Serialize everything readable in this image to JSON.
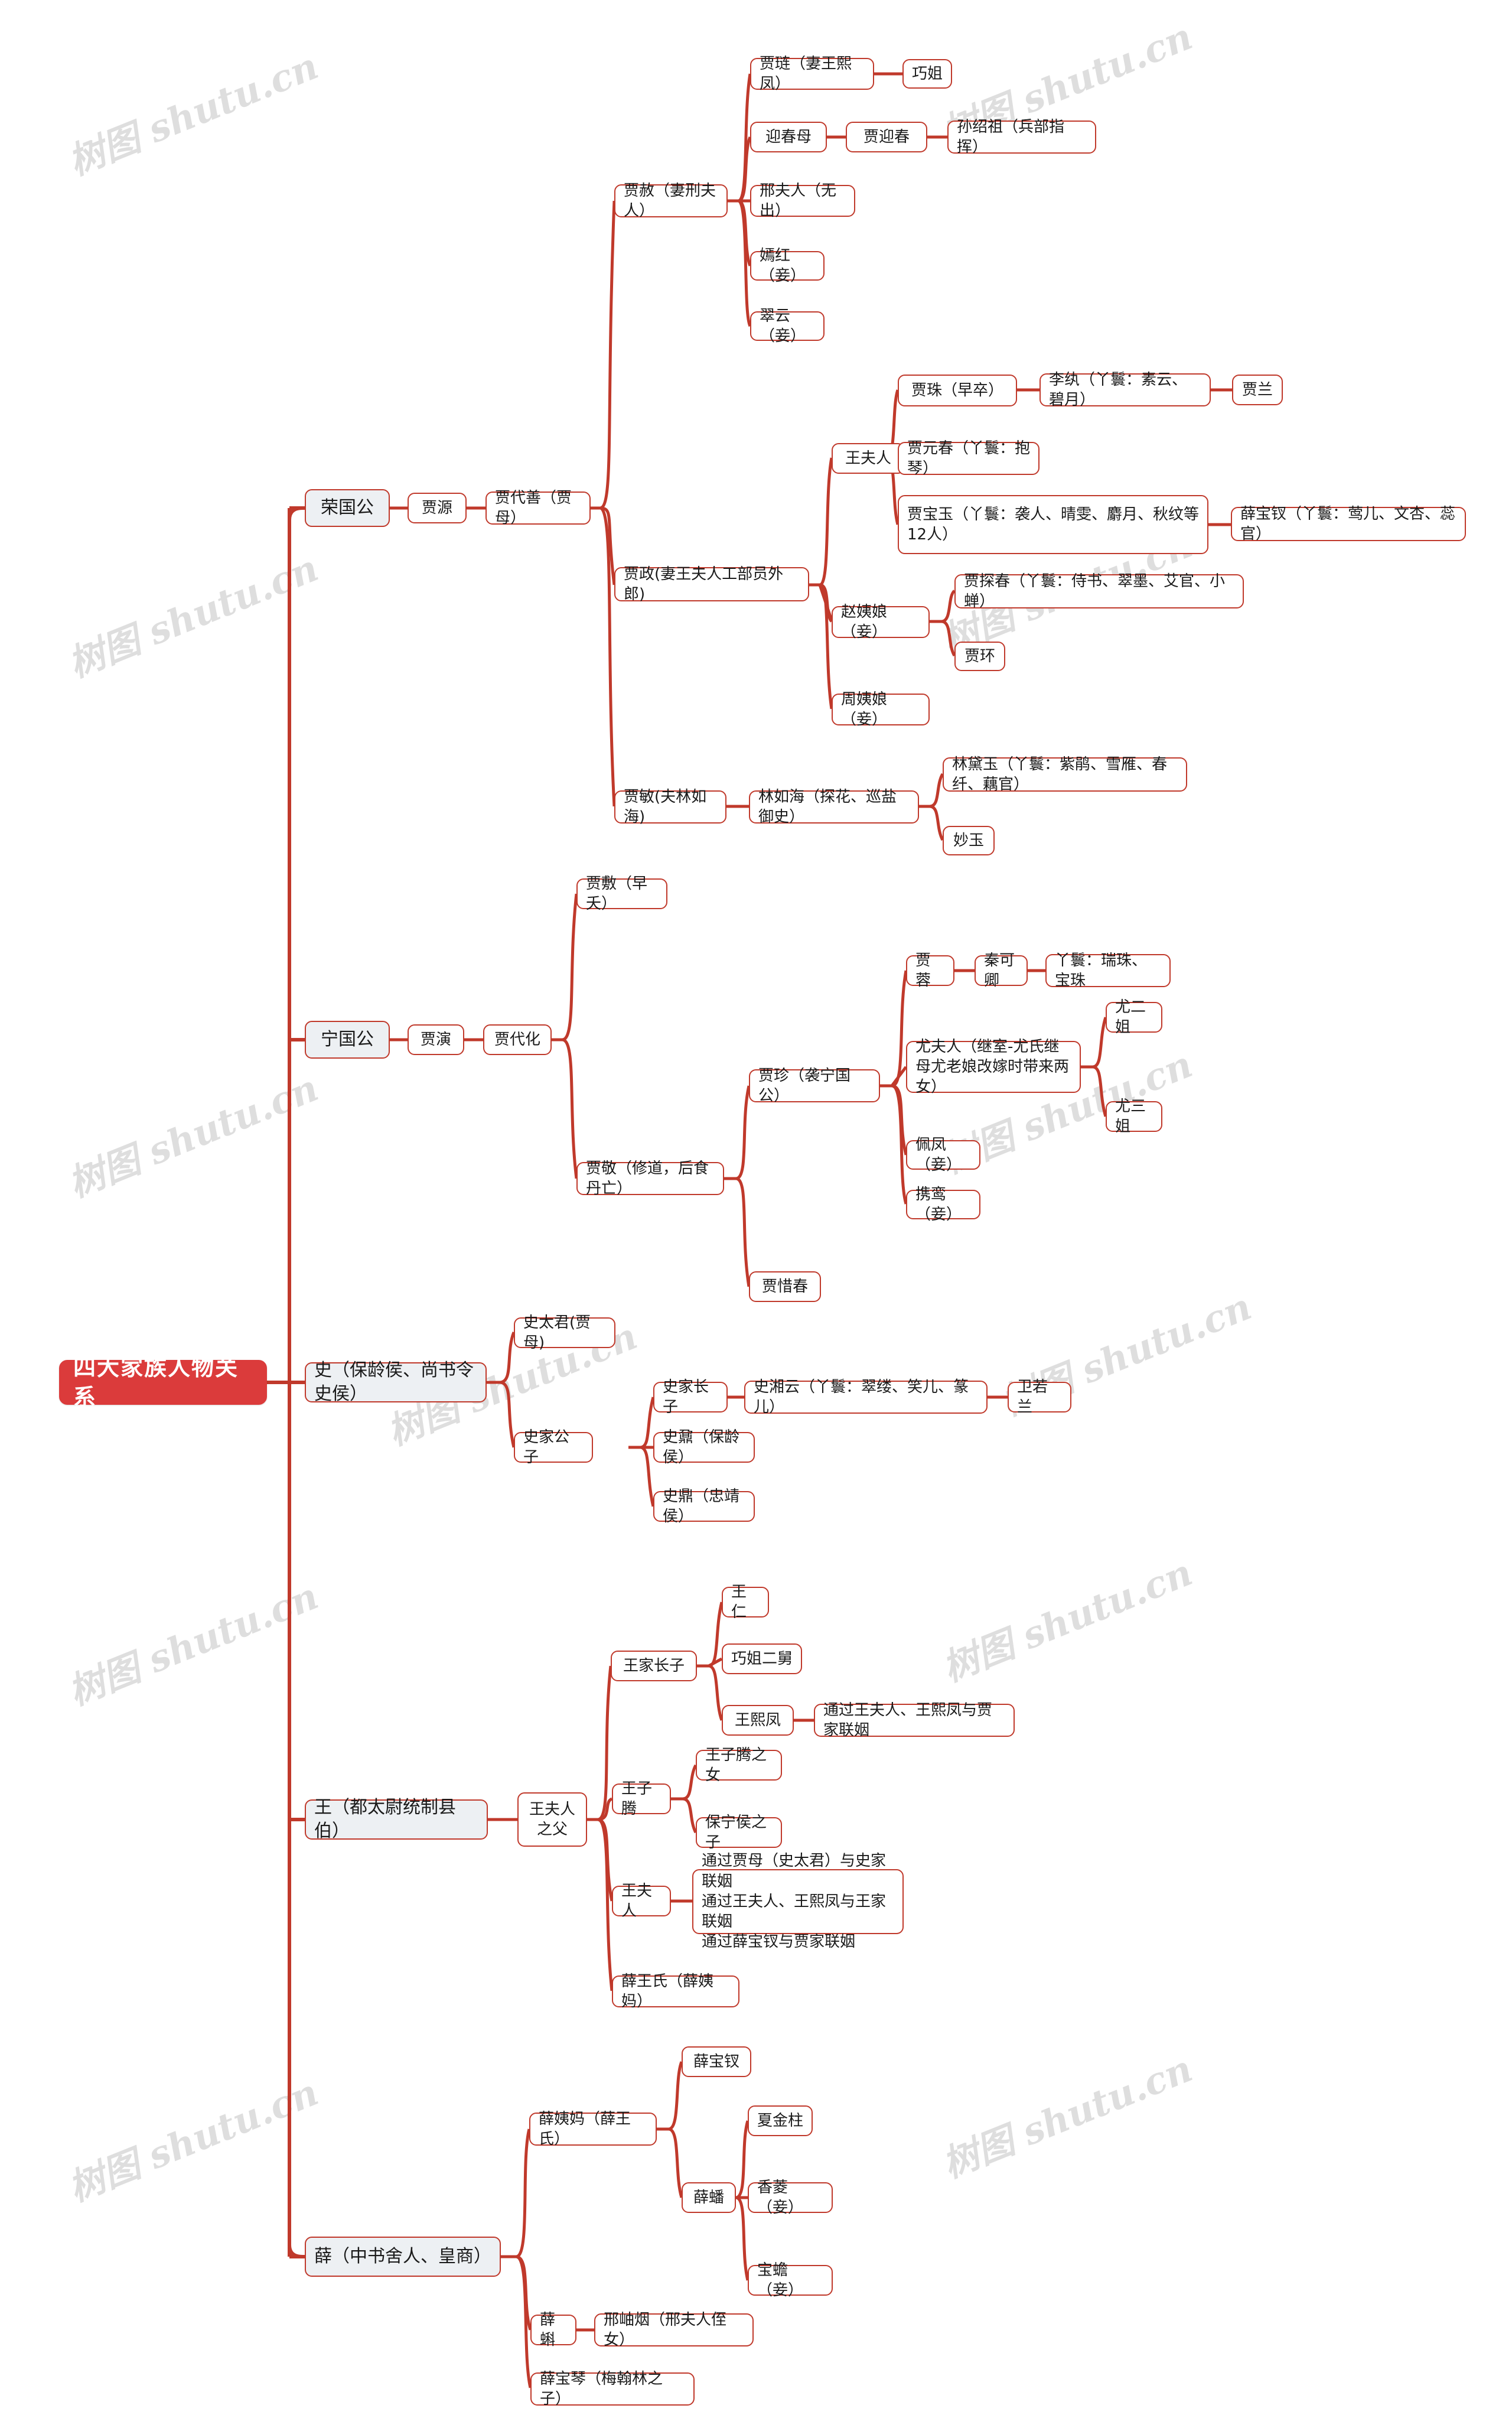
{
  "theme": {
    "accent": "#c0392b",
    "root_bg": "#db3b3b",
    "root_text": "#ffffff",
    "level1_bg": "#edf0f3",
    "node_bg": "#ffffff",
    "node_text": "#1a1a1a",
    "background": "#ffffff",
    "watermark_color": "#dedede"
  },
  "watermark": {
    "text": "树图 shutu.cn"
  },
  "root": {
    "label": "四大家族人物关系"
  },
  "nodes": {
    "rongguogong": "荣国公",
    "jiayuan": "贾源",
    "jiadaishan": "贾代善（贾母）",
    "jiashe": "贾赦（妻刑夫人）",
    "jialian": "贾琏（妻王熙凤）",
    "qiaojie": "巧姐",
    "yingchunmu": "迎春母",
    "jiayingchun": "贾迎春",
    "sunshaozu": "孙绍祖（兵部指挥）",
    "xingfuren": "邢夫人（无出）",
    "yanhong": "嫣红（妾）",
    "cuiyun": "翠云（妾）",
    "jiazheng": "贾政(妻王夫人工部员外郎)",
    "wangfuren": "王夫人",
    "jiazhu": "贾珠（早卒）",
    "liwan": "李纨（丫鬟：素云、碧月）",
    "jialan": "贾兰",
    "jiayuanchun": "贾元春（丫鬟：抱琴）",
    "jiabaoyu": "贾宝玉（丫鬟：袭人、晴雯、麝月、秋纹等12人）",
    "xuebaochai": "薛宝钗（丫鬟：莺儿、文杏、蕊官）",
    "zhaoyiniang": "赵姨娘（妾）",
    "jiatanchun": "贾探春（丫鬟：侍书、翠墨、艾官、小蝉）",
    "jiahuan": "贾环",
    "zhouyiniang": "周姨娘（妾）",
    "jiamin": "贾敏(夫林如海)",
    "linruhai": "林如海（探花、巡盐御史）",
    "lindaiyu": "林黛玉（丫鬟：紫鹃、雪雁、春纤、藕官）",
    "miaoyu": "妙玉",
    "ningguogong": "宁国公",
    "jiayan": "贾演",
    "jiadaihua": "贾代化",
    "jiafu": "贾敷（早夭）",
    "jiajing": "贾敬（修道，后食丹亡）",
    "jiazhen": "贾珍（袭宁国公）",
    "jiarong": "贾蓉",
    "qinkeqing": "秦可卿",
    "qin_yahuan": "丫鬟：瑞珠、宝珠",
    "youfuren": "尤夫人（继室-尤氏继母尤老娘改嫁时带来两女）",
    "youerjie": "尤二姐",
    "yousanjie": "尤三姐",
    "peifeng": "佩凤（妾）",
    "xieluan": "携鸾（妾）",
    "jiaxichun": "贾惜春",
    "shi": "史（保龄侯、尚书令史侯）",
    "shitaijun": "史太君(贾母)",
    "shijiagongzi": "史家公子",
    "shijiazhangzi": "史家长子",
    "shixiangyun": "史湘云（丫鬟：翠缕、笑儿、篆儿）",
    "weiruolan": "卫若兰",
    "shiding_baoling": "史鼐（保龄侯）",
    "shiding_zhongjing": "史鼎（忠靖侯）",
    "wang": "王（都太尉统制县伯）",
    "wangfuren_zhifu": "王夫人\n之父",
    "wangjiazhangzi": "王家长子",
    "wangren": "王仁",
    "qiaojieerjiu": "巧姐二舅",
    "wangxifeng": "王熙凤",
    "wangxifeng_note": "通过王夫人、王熙凤与贾家联姻",
    "wangziteng": "王子腾",
    "wangzitengzhinv": "王子腾之女",
    "baoninghouzhizi": "保宁侯之子",
    "wangfuren2": "王夫人",
    "wangfuren2_note": "通过贾母（史太君）与史家联姻\n通过王夫人、王熙凤与王家联姻\n通过薛宝钗与贾家联姻",
    "xuewangshi": "薛王氏（薛姨妈）",
    "xue": "薛（中书舍人、皇商）",
    "xueyima": "薛姨妈（薛王氏）",
    "xuebaochai2": "薛宝钗",
    "xuepan": "薛蟠",
    "xiajinzhu": "夏金柱",
    "xiangling": "香菱（妾）",
    "baochan": "宝蟾（妾）",
    "xueke": "薛蝌",
    "xingxiuyan": "邢岫烟（邢夫人侄女）",
    "xuebaoqin": "薛宝琴（梅翰林之子）"
  }
}
